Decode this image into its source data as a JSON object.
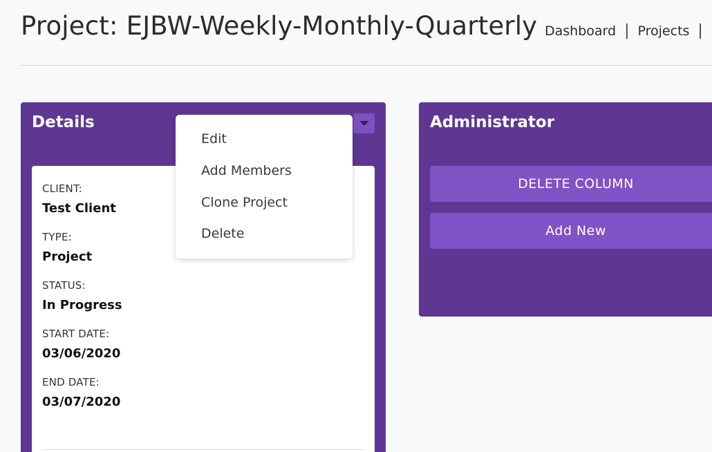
{
  "header": {
    "title": "Project: EJBW-Weekly-Monthly-Quarterly",
    "nav": [
      "Dashboard",
      "Projects"
    ]
  },
  "details": {
    "title": "Details",
    "fields": [
      {
        "label": "CLIENT:",
        "value": "Test Client"
      },
      {
        "label": "TYPE:",
        "value": "Project"
      },
      {
        "label": "STATUS:",
        "value": "In Progress"
      },
      {
        "label": "START DATE:",
        "value": "03/06/2020"
      },
      {
        "label": "END DATE:",
        "value": "03/07/2020"
      }
    ],
    "menu": [
      "Edit",
      "Add Members",
      "Clone Project",
      "Delete"
    ]
  },
  "administrator": {
    "title": "Administrator",
    "buttons": [
      "DELETE COLUMN",
      "Add New"
    ]
  },
  "colors": {
    "card_purple": "#5e3793",
    "button_purple": "#8152c6",
    "page_bg": "#f8f9fa"
  }
}
